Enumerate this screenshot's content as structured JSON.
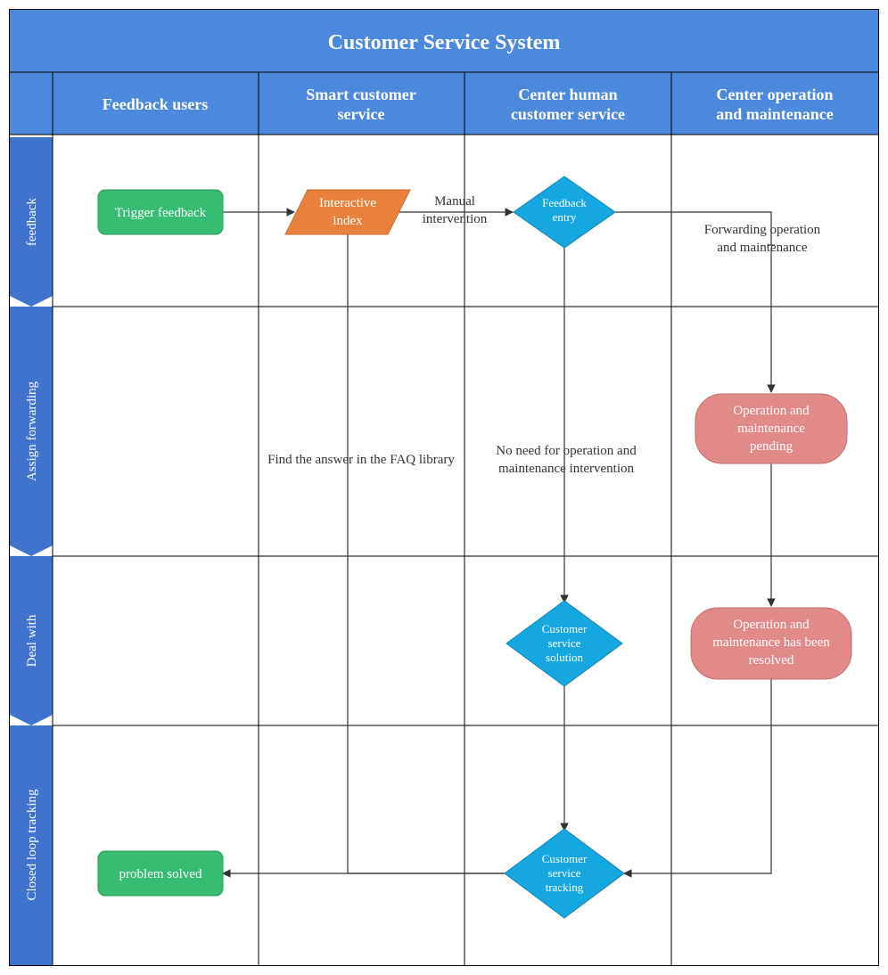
{
  "title": "Customer Service System",
  "columns": [
    "Feedback users",
    "Smart customer service",
    "Center human customer service",
    "Center operation and maintenance"
  ],
  "rows": [
    "feedback",
    "Assign forwarding",
    "Deal with",
    "Closed loop tracking"
  ],
  "nodes": {
    "trigger_feedback": "Trigger feedback",
    "interactive_index_l1": "Interactive",
    "interactive_index_l2": "index",
    "feedback_entry_l1": "Feedback",
    "feedback_entry_l2": "entry",
    "om_pending_l1": "Operation and",
    "om_pending_l2": "maintenance",
    "om_pending_l3": "pending",
    "cs_solution_l1": "Customer",
    "cs_solution_l2": "service",
    "cs_solution_l3": "solution",
    "om_resolved_l1": "Operation and",
    "om_resolved_l2": "maintenance has been",
    "om_resolved_l3": "resolved",
    "cs_tracking_l1": "Customer",
    "cs_tracking_l2": "service",
    "cs_tracking_l3": "tracking",
    "problem_solved": "problem solved"
  },
  "edges": {
    "manual_intervention_l1": "Manual",
    "manual_intervention_l2": "intervention",
    "forwarding_om_l1": "Forwarding operation",
    "forwarding_om_l2": "and maintenance",
    "no_need_l1": "No need for operation and",
    "no_need_l2": "maintenance intervention",
    "faq": "Find the answer in the FAQ library"
  },
  "colors": {
    "blueHeader": "#4A89DC",
    "blueSide": "#3E74CD",
    "green": "#37BC74",
    "orange": "#E9803C",
    "cyan": "#14A7E0",
    "pink": "#E28989",
    "stroke": "#333333"
  },
  "chart_data": {
    "type": "swimlane-flowchart",
    "title": "Customer Service System",
    "columns": [
      "Feedback users",
      "Smart customer service",
      "Center human customer service",
      "Center operation and maintenance"
    ],
    "rows": [
      "feedback",
      "Assign forwarding",
      "Deal with",
      "Closed loop tracking"
    ],
    "nodes": [
      {
        "id": "trigger",
        "label": "Trigger feedback",
        "shape": "rounded-rect",
        "col": 0,
        "row": 0,
        "color": "green"
      },
      {
        "id": "interactive",
        "label": "Interactive index",
        "shape": "parallelogram",
        "col": 1,
        "row": 0,
        "color": "orange"
      },
      {
        "id": "feedback_entry",
        "label": "Feedback entry",
        "shape": "diamond",
        "col": 2,
        "row": 0,
        "color": "cyan"
      },
      {
        "id": "om_pending",
        "label": "Operation and maintenance pending",
        "shape": "rounded-rect",
        "col": 3,
        "row": 1,
        "color": "pink"
      },
      {
        "id": "cs_solution",
        "label": "Customer service solution",
        "shape": "diamond",
        "col": 2,
        "row": 2,
        "color": "cyan"
      },
      {
        "id": "om_resolved",
        "label": "Operation and maintenance has been resolved",
        "shape": "rounded-rect",
        "col": 3,
        "row": 2,
        "color": "pink"
      },
      {
        "id": "cs_tracking",
        "label": "Customer service tracking",
        "shape": "diamond",
        "col": 2,
        "row": 3,
        "color": "cyan"
      },
      {
        "id": "solved",
        "label": "problem solved",
        "shape": "rounded-rect",
        "col": 0,
        "row": 3,
        "color": "green"
      }
    ],
    "edges": [
      {
        "from": "trigger",
        "to": "interactive",
        "label": ""
      },
      {
        "from": "interactive",
        "to": "feedback_entry",
        "label": "Manual intervention"
      },
      {
        "from": "feedback_entry",
        "to": "om_pending_path",
        "label": "Forwarding operation and maintenance",
        "via": "right-then-down"
      },
      {
        "from": "om_pending_path",
        "to": "om_pending",
        "label": ""
      },
      {
        "from": "feedback_entry",
        "to": "cs_solution",
        "label": "No need for operation and maintenance intervention"
      },
      {
        "from": "interactive",
        "to": "cs_tracking",
        "label": "Find the answer in the FAQ library",
        "via": "down"
      },
      {
        "from": "om_pending",
        "to": "om_resolved",
        "label": ""
      },
      {
        "from": "cs_solution",
        "to": "cs_tracking",
        "label": ""
      },
      {
        "from": "om_resolved",
        "to": "cs_tracking",
        "label": "",
        "via": "down-then-left"
      },
      {
        "from": "cs_tracking",
        "to": "solved",
        "label": ""
      }
    ]
  }
}
